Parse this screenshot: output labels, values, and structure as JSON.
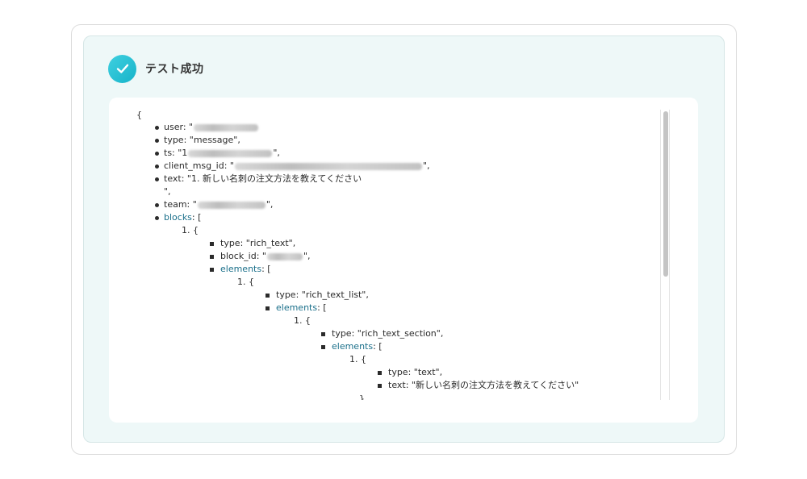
{
  "header": {
    "title": "テスト成功",
    "icon": "check-circle-icon",
    "accent": "#22c1d6"
  },
  "json_view": {
    "open_brace": "{",
    "user": {
      "key": "user",
      "prefix": ": \""
    },
    "type": {
      "key": "type",
      "text": ": \"message\","
    },
    "ts": {
      "key": "ts",
      "prefix": ": \"1",
      "suffix": "\","
    },
    "client_msg_id": {
      "key": "client_msg_id",
      "prefix": ": \"",
      "suffix": "\","
    },
    "text": {
      "key": "text",
      "line1": ": \"1. 新しい名刺の注文方法を教えてください",
      "line2": "\","
    },
    "team": {
      "key": "team",
      "prefix": ": \"",
      "suffix": "\","
    },
    "blocks": {
      "key": "blocks",
      "text": ": ["
    },
    "blocks_item": "1. {",
    "block_type": {
      "key": "type",
      "text": ": \"rich_text\","
    },
    "block_id": {
      "key": "block_id",
      "prefix": ": \"",
      "suffix": "\","
    },
    "elements1": {
      "key": "elements",
      "text": ": ["
    },
    "elements1_item": "1. {",
    "el1_type": {
      "key": "type",
      "text": ": \"rich_text_list\","
    },
    "elements2": {
      "key": "elements",
      "text": ": ["
    },
    "elements2_item": "1. {",
    "el2_type": {
      "key": "type",
      "text": ": \"rich_text_section\","
    },
    "elements3": {
      "key": "elements",
      "text": ": ["
    },
    "elements3_item": "1. {",
    "el3_type": {
      "key": "type",
      "text": ": \"text\","
    },
    "el3_text": {
      "key": "text",
      "text": ": \"新しい名刺の注文方法を教えてください\""
    },
    "close_brace": "}"
  },
  "colors": {
    "link_key": "#1a6f8a",
    "panel_bg": "#eef8f8"
  }
}
